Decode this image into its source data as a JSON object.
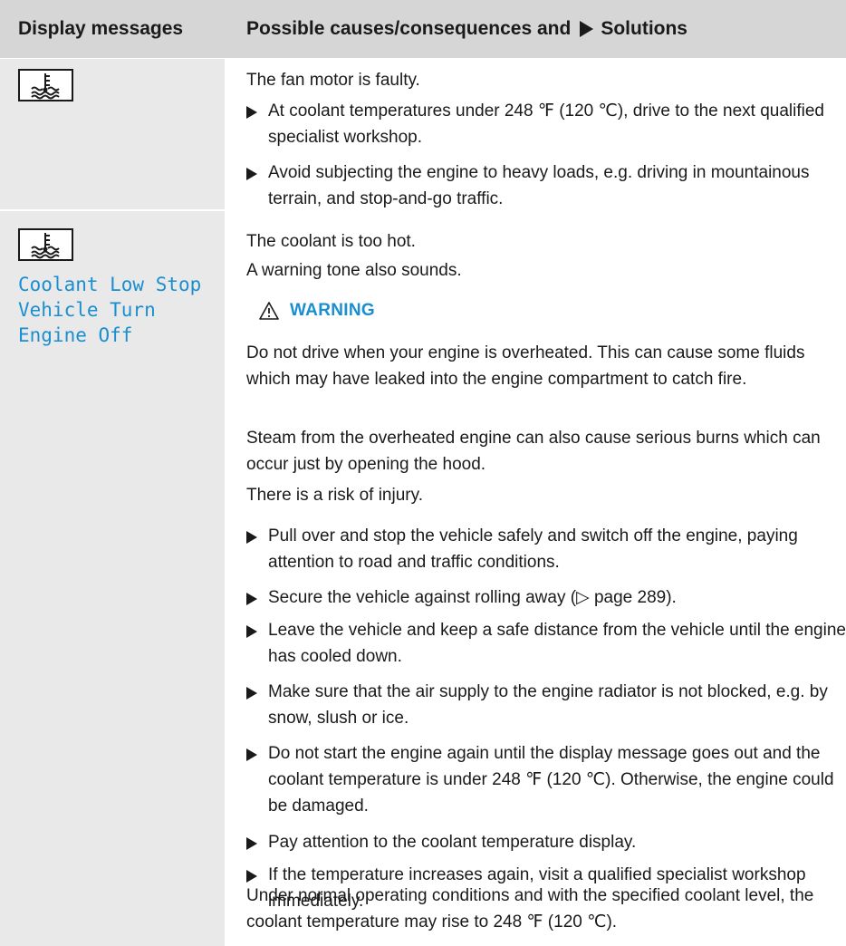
{
  "header": {
    "col1": "Display messages",
    "col2_before": "Possible causes/consequences and",
    "col2_after": "Solutions"
  },
  "row1": {
    "icon": "coolant-temperature-icon",
    "cause": "The fan motor is faulty.",
    "solutions": [
      "At coolant temperatures under 248 ℉ (120 ℃), drive to the next qualified specialist workshop.",
      "Avoid subjecting the engine to heavy loads, e.g. driving in mountainous terrain, and stop-and-go traffic."
    ]
  },
  "row2": {
    "icon": "coolant-temperature-icon",
    "display_message": "Coolant Low Stop\nVehicle Turn\nEngine Off",
    "cause": "The coolant is too hot.",
    "tone": "A warning tone also sounds.",
    "warning_label": "WARNING",
    "warning_text": [
      "Do not drive when your engine is overheated. This can cause some fluids which may have leaked into the engine compartment to catch fire.",
      "Steam from the overheated engine can also cause serious burns which can occur just by opening the hood.",
      "There is a risk of injury."
    ],
    "solutions": [
      "Pull over and stop the vehicle safely and switch off the engine, paying attention to road and traffic conditions.",
      "Secure the vehicle against rolling away (▷ page 289).",
      "Leave the vehicle and keep a safe distance from the vehicle until the engine has cooled down.",
      "Make sure that the air supply to the engine radiator is not blocked, e.g. by snow, slush or ice.",
      "Do not start the engine again until the display message goes out and the coolant temperature is under 248 ℉ (120 ℃). Otherwise, the engine could be damaged.",
      "Pay attention to the coolant temperature display.",
      "If the temperature increases again, visit a qualified specialist workshop immediately."
    ],
    "note": "Under normal operating conditions and with the specified coolant level, the coolant temperature may rise to 248 ℉ (120 ℃)."
  },
  "colors": {
    "header_bg": "#d6d6d6",
    "left_col_bg": "#e9e9e9",
    "accent_blue": "#1a8fd0"
  }
}
